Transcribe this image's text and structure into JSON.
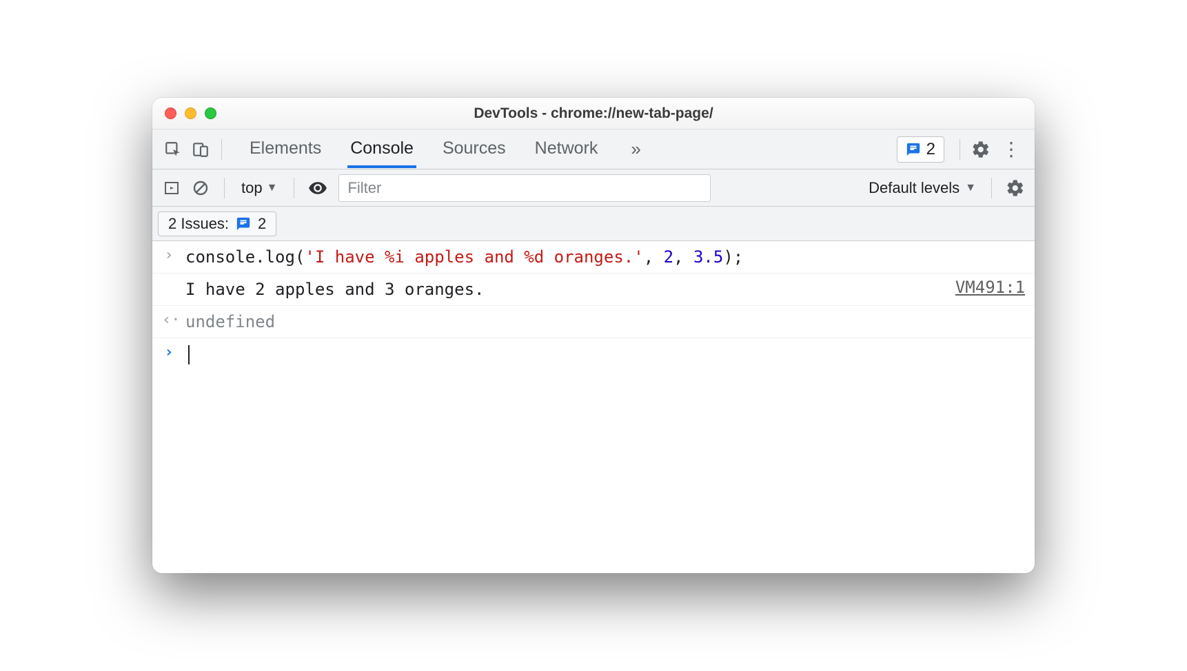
{
  "window": {
    "title": "DevTools - chrome://new-tab-page/"
  },
  "tabs": {
    "elements": "Elements",
    "console": "Console",
    "sources": "Sources",
    "network": "Network"
  },
  "issues_badge": {
    "count": "2"
  },
  "toolbar": {
    "context": "top",
    "filter_placeholder": "Filter",
    "levels": "Default levels"
  },
  "issues_bar": {
    "label": "2 Issues:",
    "count": "2"
  },
  "console_rows": {
    "input": {
      "call": "console.log",
      "open": "(",
      "str": "'I have %i apples and %d oranges.'",
      "comma1": ", ",
      "num1": "2",
      "comma2": ", ",
      "num2": "3.5",
      "close": ");"
    },
    "output": {
      "text": "I have 2 apples and 3 oranges.",
      "source": "VM491:1"
    },
    "return": {
      "text": "undefined"
    }
  }
}
